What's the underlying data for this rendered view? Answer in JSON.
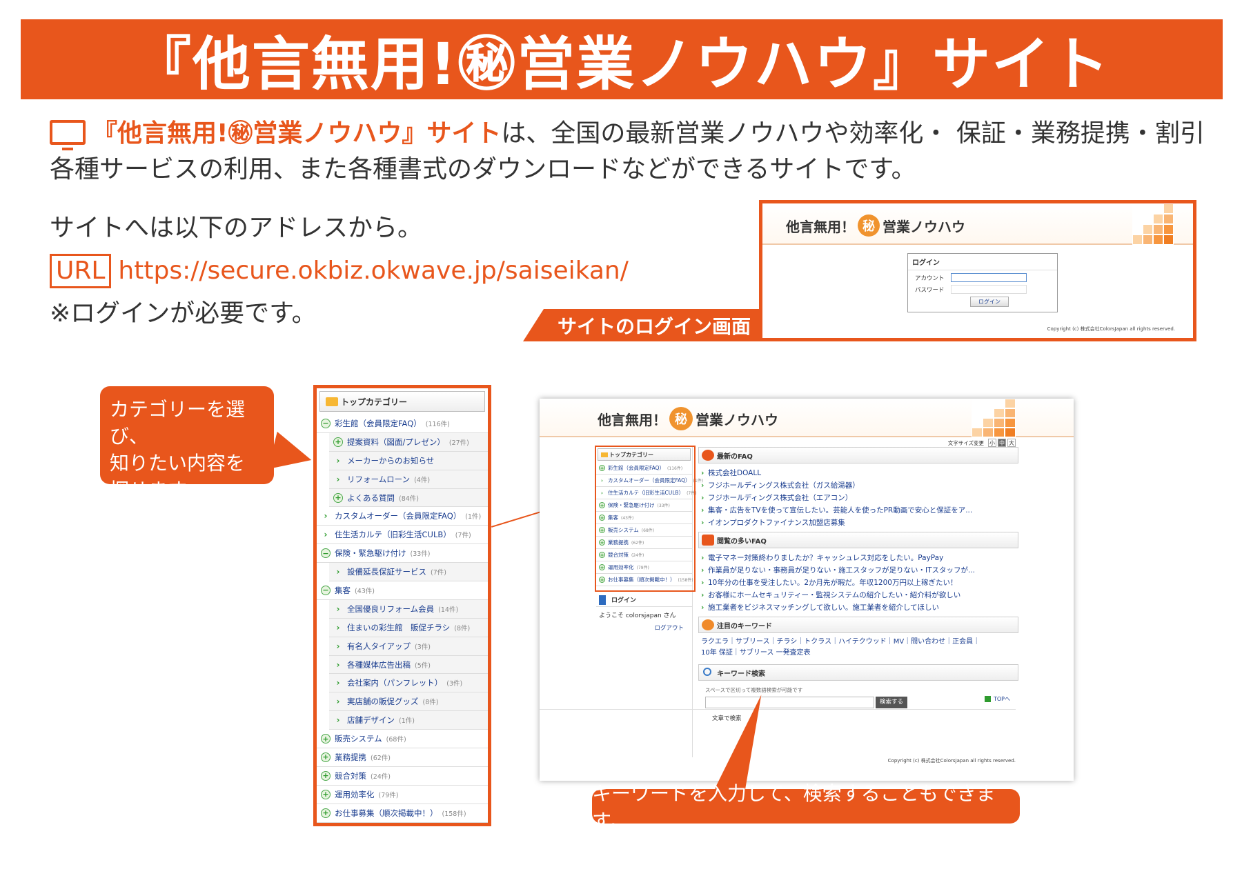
{
  "banner": {
    "title": "『他言無用!㊙営業ノウハウ』サイト"
  },
  "intro": {
    "highlight": "『他言無用!㊙営業ノウハウ』サイト",
    "line1_rest": "は、全国の最新営業ノウハウや効率化・ 保証・業務提携・割引",
    "line2": "各種サービスの利用、また各種書式のダウンロードなどができるサイトです。"
  },
  "address": {
    "lead": "サイトへは以下のアドレスから。",
    "url_badge": "URL",
    "url": "https://secure.okbiz.okwave.jp/saiseikan/",
    "note": "※ログインが必要です。"
  },
  "login_panel": {
    "tab_label": "サイトのログイン画面",
    "logo_text1": "他言無用！",
    "logo_maru": "秘",
    "logo_text2": "営業ノウハウ",
    "box_title": "ログイン",
    "account_label": "アカウント",
    "password_label": "パスワード",
    "login_button": "ログイン",
    "copyright": "Copyright (c) 株式会社ColorsJapan all rights reserved."
  },
  "callouts": {
    "category": [
      "カテゴリーを選び、",
      "知りたい内容を",
      "探せます。"
    ],
    "keyword": "キーワードを入力して、検索することもできます。"
  },
  "categories": {
    "header": "トップカテゴリー",
    "items": [
      {
        "icon": "minus",
        "label": "彩生館（会員限定FAQ）",
        "count": "(116件)",
        "sub": false
      },
      {
        "icon": "plus",
        "label": "提案資料（図面/プレゼン）",
        "count": "(27件)",
        "sub": true
      },
      {
        "icon": "arrow",
        "label": "メーカーからのお知らせ",
        "count": "",
        "sub": true
      },
      {
        "icon": "arrow",
        "label": "リフォームローン",
        "count": "(4件)",
        "sub": true
      },
      {
        "icon": "plus",
        "label": "よくある質問",
        "count": "(84件)",
        "sub": true
      },
      {
        "icon": "arrow",
        "label": "カスタムオーダー（会員限定FAQ）",
        "count": "(1件)",
        "sub": false
      },
      {
        "icon": "arrow",
        "label": "住生活カルテ（旧彩生活CULB）",
        "count": "(7件)",
        "sub": false
      },
      {
        "icon": "minus",
        "label": "保険・緊急駆け付け",
        "count": "(33件)",
        "sub": false
      },
      {
        "icon": "arrow",
        "label": "設備延長保証サービス",
        "count": "(7件)",
        "sub": true
      },
      {
        "icon": "minus",
        "label": "集客",
        "count": "(43件)",
        "sub": false
      },
      {
        "icon": "arrow",
        "label": "全国優良リフォーム会員",
        "count": "(14件)",
        "sub": true
      },
      {
        "icon": "arrow",
        "label": "住まいの彩生館　販促チラシ",
        "count": "(8件)",
        "sub": true
      },
      {
        "icon": "arrow",
        "label": "有名人タイアップ",
        "count": "(3件)",
        "sub": true
      },
      {
        "icon": "arrow",
        "label": "各種媒体広告出稿",
        "count": "(5件)",
        "sub": true
      },
      {
        "icon": "arrow",
        "label": "会社案内（パンフレット）",
        "count": "(3件)",
        "sub": true
      },
      {
        "icon": "arrow",
        "label": "実店舗の販促グッズ",
        "count": "(8件)",
        "sub": true
      },
      {
        "icon": "arrow",
        "label": "店舗デザイン",
        "count": "(1件)",
        "sub": true
      },
      {
        "icon": "plus",
        "label": "販売システム",
        "count": "(68件)",
        "sub": false
      },
      {
        "icon": "plus",
        "label": "業務提携",
        "count": "(62件)",
        "sub": false
      },
      {
        "icon": "plus",
        "label": "競合対策",
        "count": "(24件)",
        "sub": false
      },
      {
        "icon": "plus",
        "label": "運用効率化",
        "count": "(79件)",
        "sub": false
      },
      {
        "icon": "plus",
        "label": "お仕事募集（順次掲載中！）",
        "count": "(158件)",
        "sub": false
      }
    ]
  },
  "main_screen": {
    "font_size_label": "文字サイズ変更",
    "font_sizes": [
      "小",
      "中",
      "大"
    ],
    "mini_categories": [
      {
        "icon": "plus",
        "label": "彩生館（会員限定FAQ）",
        "count": "(116件)"
      },
      {
        "icon": "arrow",
        "label": "カスタムオーダー（会員限定FAQ）",
        "count": "(1件)"
      },
      {
        "icon": "arrow",
        "label": "住生活カルテ（旧彩生活CULB）",
        "count": "(7件)"
      },
      {
        "icon": "plus",
        "label": "保険・緊急駆け付け",
        "count": "(33件)"
      },
      {
        "icon": "plus",
        "label": "集客",
        "count": "(43件)"
      },
      {
        "icon": "plus",
        "label": "販売システム",
        "count": "(68件)"
      },
      {
        "icon": "plus",
        "label": "業務提携",
        "count": "(62件)"
      },
      {
        "icon": "plus",
        "label": "競合対策",
        "count": "(24件)"
      },
      {
        "icon": "plus",
        "label": "運用効率化",
        "count": "(79件)"
      },
      {
        "icon": "plus",
        "label": "お仕事募集（順次掲載中！）",
        "count": "(158件)"
      }
    ],
    "login_title": "ログイン",
    "welcome": "ようこそ colorsjapan さん",
    "logout": "ログアウト",
    "latest_faq_title": "最新のFAQ",
    "latest_faq": [
      "株式会社DOALL",
      "フジホールディングス株式会社（ガス給湯器）",
      "フジホールディングス株式会社（エアコン）",
      "集客・広告をTVを使って宣伝したい。芸能人を使ったPR動画で安心と保証をア...",
      "イオンプロダクトファイナンス加盟店募集"
    ],
    "popular_faq_title": "閲覧の多いFAQ",
    "popular_faq": [
      "電子マネー対策終わりましたか？キャッシュレス対応をしたい。PayPay",
      "作業員が足りない・事務員が足りない・施工スタッフが足りない・ITスタッフが...",
      "10年分の仕事を受注したい。2か月先が暇だ。年収1200万円以上稼ぎたい！",
      "お客様にホームセキュリティー・監視システムの紹介したい・紹介料が欲しい",
      "施工業者をビジネスマッチングして欲しい。施工業者を紹介してほしい"
    ],
    "keywords_title": "注目のキーワード",
    "keywords_line1": "ラクエラ｜サブリース｜チラシ｜トクラス｜ハイテクウッド｜MV｜問い合わせ｜正会員｜",
    "keywords_line2": "10年 保証｜サブリース 一発査定表",
    "search_title": "キーワード検索",
    "search_hint": "スペースで区切って複数語検索が可能です",
    "search_button": "検索する",
    "fulltext_label": "文章で検索",
    "top_link": "TOPへ",
    "copyright": "Copyright (c) 株式会社ColorsJapan all rights reserved."
  },
  "colors": {
    "accent": "#e8561c",
    "link": "#1a3d8f",
    "green": "#2e9b2e"
  }
}
